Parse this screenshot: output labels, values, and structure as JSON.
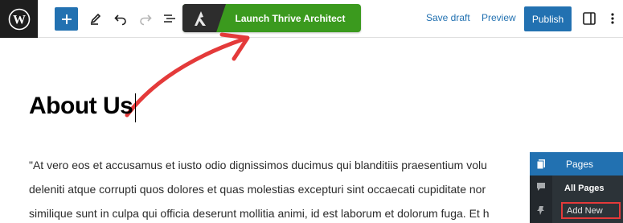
{
  "toolbar": {
    "thrive_label": "Launch Thrive Architect",
    "save_draft_label": "Save draft",
    "preview_label": "Preview",
    "publish_label": "Publish",
    "icons": [
      "wordpress-logo-icon",
      "plus-icon",
      "pencil-icon",
      "undo-icon",
      "redo-icon",
      "list-view-icon",
      "thrive-architect-logo-icon",
      "sidebar-settings-icon",
      "more-options-icon"
    ]
  },
  "editor": {
    "title": "About Us",
    "body_lines": [
      "\"At vero eos et accusamus et iusto odio dignissimos ducimus qui blanditiis praesentium volu",
      "deleniti atque corrupti quos dolores et quas molestias excepturi sint occaecati cupiditate nor",
      "similique sunt in culpa qui officia deserunt mollitia animi, id est laborum et dolorum fuga. Et h"
    ]
  },
  "admin_menu": {
    "section_label": "Pages",
    "items": [
      {
        "label": "All Pages"
      },
      {
        "label": "Add New"
      }
    ]
  },
  "colors": {
    "accent_blue": "#2271b1",
    "thrive_green": "#3b9a1e",
    "annotation_red": "#e43a3a",
    "admin_dark": "#1d2327"
  }
}
